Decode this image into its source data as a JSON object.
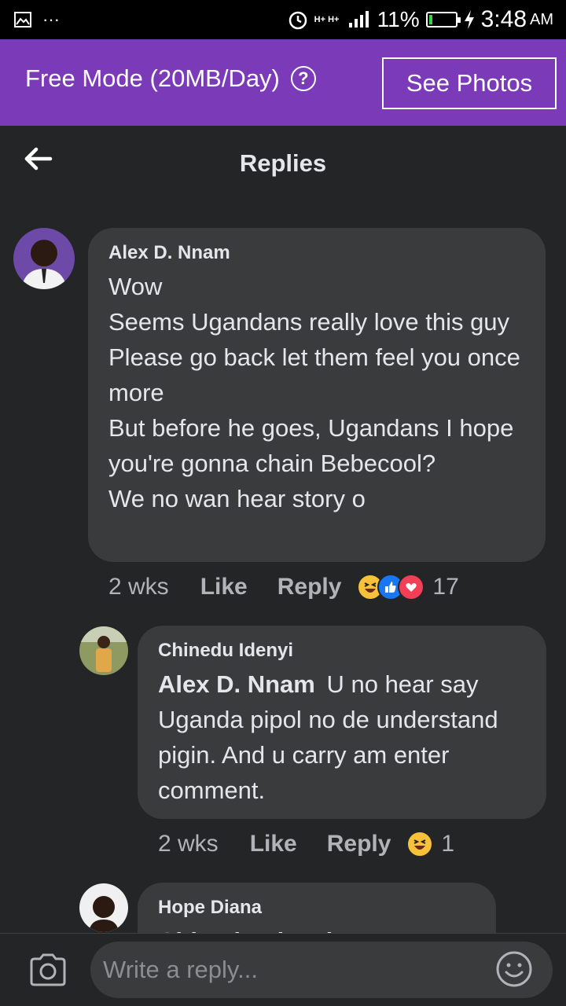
{
  "status_bar": {
    "notif": "···",
    "network": "H+ H+",
    "battery_pct": "11%",
    "battery_level": 0.11,
    "time": "3:48",
    "ampm": "AM"
  },
  "promo": {
    "mode_label": "Free Mode (20MB/Day)",
    "help_icon": "?",
    "button_label": "See Photos"
  },
  "header": {
    "title": "Replies"
  },
  "comments": [
    {
      "author": "Alex D. Nnam",
      "text": "Wow\nSeems Ugandans really love this guy\nPlease go back let them feel you once more\nBut before he goes, Ugandans I hope you're gonna chain Bebecool?\nWe no wan hear story o",
      "time": "2 wks",
      "like": "Like",
      "reply": "Reply",
      "reactions": [
        "haha",
        "like",
        "love"
      ],
      "count": "17"
    },
    {
      "author": "Chinedu Idenyi",
      "tag": "Alex D. Nnam",
      "text": "U no hear say Uganda pipol no de understand pigin. And u carry am enter comment.",
      "time": "2 wks",
      "like": "Like",
      "reply": "Reply",
      "reactions": [
        "haha"
      ],
      "count": "1"
    },
    {
      "author": "Hope Diana",
      "text": "Chinedu Idenyi"
    }
  ],
  "composer": {
    "placeholder": "Write a reply..."
  }
}
